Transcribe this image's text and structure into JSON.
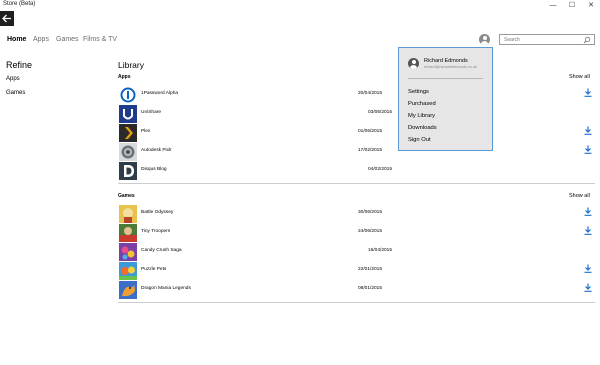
{
  "window": {
    "title": "Store (Beta)",
    "controls": {
      "minimize": "—",
      "maximize": "☐",
      "close": "✕"
    }
  },
  "nav": {
    "tabs": [
      {
        "label": "Home",
        "active": true
      },
      {
        "label": "Apps",
        "active": false
      },
      {
        "label": "Games",
        "active": false
      },
      {
        "label": "Films & TV",
        "active": false
      }
    ]
  },
  "search": {
    "placeholder": "Search"
  },
  "refine": {
    "title": "Refine",
    "items": [
      "Apps",
      "Games"
    ]
  },
  "library": {
    "title": "Library",
    "sections": [
      {
        "name": "Apps",
        "show_all": "Show all",
        "items": [
          {
            "name": "1Password Alpha",
            "date": "20/04/2015",
            "downloadable": true,
            "thumb": "1password-logo",
            "color": "#0d63c9"
          },
          {
            "name": "UniShare",
            "date": "03/06/2015",
            "downloadable": false,
            "thumb": "unishare-logo",
            "color": "#1f3b8c"
          },
          {
            "name": "Plex",
            "date": "01/06/2015",
            "downloadable": true,
            "thumb": "plex-logo",
            "color": "#2a2a2a"
          },
          {
            "name": "Autodesk Pixlr",
            "date": "17/02/2015",
            "downloadable": true,
            "thumb": "pixlr-logo",
            "color": "#6d7378"
          },
          {
            "name": "Disqus Blog",
            "date": "04/02/2015",
            "downloadable": false,
            "thumb": "disqus-logo",
            "color": "#2f3d4a"
          }
        ]
      },
      {
        "name": "Games",
        "show_all": "Show all",
        "items": [
          {
            "name": "Battle Odyssey",
            "date": "30/06/2015",
            "downloadable": true,
            "thumb": "battle-odyssey-art",
            "color": "#e9c24d"
          },
          {
            "name": "Tiny Troopers",
            "date": "24/06/2015",
            "downloadable": true,
            "thumb": "tiny-troopers-art",
            "color": "#4f7b3a"
          },
          {
            "name": "Candy Crush Saga",
            "date": "16/04/2015",
            "downloadable": false,
            "thumb": "candy-crush-art",
            "color": "#d04a7c"
          },
          {
            "name": "Puzzle Pets",
            "date": "22/01/2015",
            "downloadable": true,
            "thumb": "puzzle-pets-art",
            "color": "#3c9ad6"
          },
          {
            "name": "Dragon Mania Legends",
            "date": "08/01/2015",
            "downloadable": true,
            "thumb": "dragon-mania-art",
            "color": "#3a6ec9"
          }
        ]
      }
    ]
  },
  "account_menu": {
    "user_name": "Richard Edmonds",
    "email": "richard@richardedmonds.co.uk",
    "items": [
      "Settings",
      "Purchased",
      "My Library",
      "Downloads",
      "Sign Out"
    ]
  },
  "colors": {
    "accent": "#1e6ecf",
    "menu_bg": "#e6e6e6",
    "menu_border": "#5b9bd5",
    "back_bar": "#1f1f1f"
  }
}
